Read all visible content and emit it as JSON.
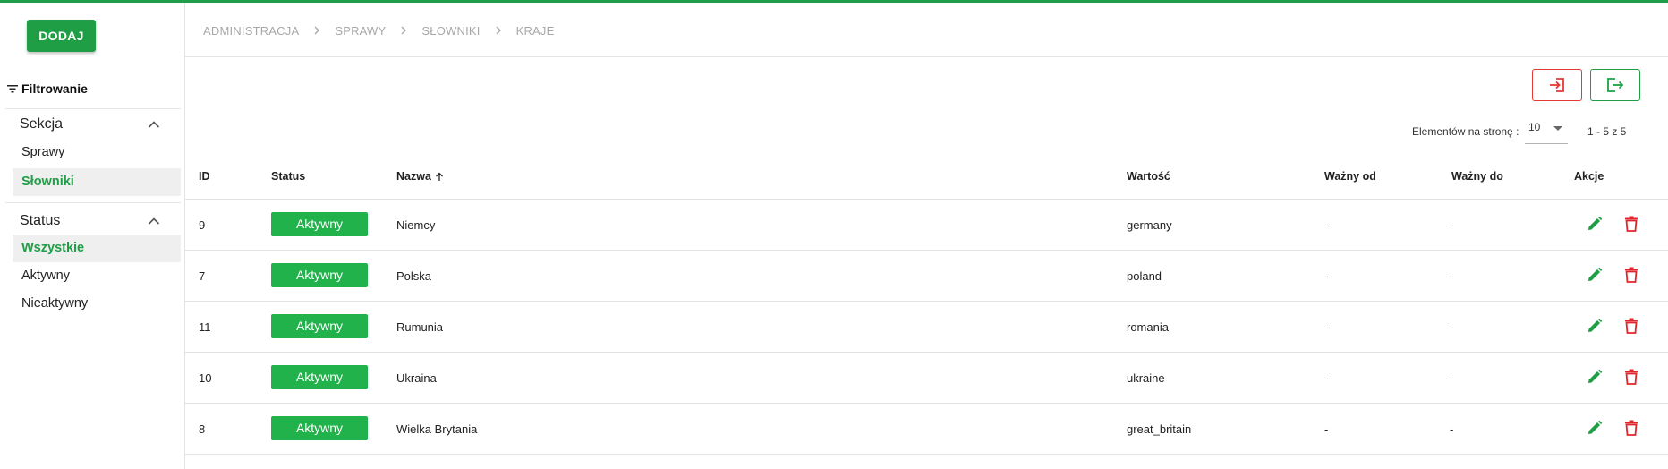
{
  "sidebar": {
    "add_label": "DODAJ",
    "filter_label": "Filtrowanie",
    "sections": [
      {
        "title": "Sekcja",
        "items": [
          {
            "label": "Sprawy",
            "active": false
          },
          {
            "label": "Słowniki",
            "active": true
          }
        ]
      },
      {
        "title": "Status",
        "items": [
          {
            "label": "Wszystkie",
            "active": true
          },
          {
            "label": "Aktywny",
            "active": false
          },
          {
            "label": "Nieaktywny",
            "active": false
          }
        ]
      }
    ]
  },
  "breadcrumb": [
    "ADMINISTRACJA",
    "SPRAWY",
    "SŁOWNIKI",
    "KRAJE"
  ],
  "pagination": {
    "per_page_label": "Elementów na stronę :",
    "per_page_value": "10",
    "range": "1 - 5 z 5"
  },
  "table": {
    "headers": {
      "id": "ID",
      "status": "Status",
      "name": "Nazwa",
      "value": "Wartość",
      "valid_from": "Ważny od",
      "valid_to": "Ważny do",
      "actions": "Akcje"
    },
    "rows": [
      {
        "id": "9",
        "status": "Aktywny",
        "name": "Niemcy",
        "value": "germany",
        "valid_from": "-",
        "valid_to": "-"
      },
      {
        "id": "7",
        "status": "Aktywny",
        "name": "Polska",
        "value": "poland",
        "valid_from": "-",
        "valid_to": "-"
      },
      {
        "id": "11",
        "status": "Aktywny",
        "name": "Rumunia",
        "value": "romania",
        "valid_from": "-",
        "valid_to": "-"
      },
      {
        "id": "10",
        "status": "Aktywny",
        "name": "Ukraina",
        "value": "ukraine",
        "valid_from": "-",
        "valid_to": "-"
      },
      {
        "id": "8",
        "status": "Aktywny",
        "name": "Wielka Brytania",
        "value": "great_britain",
        "valid_from": "-",
        "valid_to": "-"
      }
    ]
  },
  "icons": {
    "filter": "filter-icon",
    "chevron": "chevron-up-icon",
    "import": "import-icon",
    "export": "export-icon",
    "sort": "sort-arrow-up-icon",
    "edit": "pencil-icon",
    "delete": "trash-icon"
  },
  "colors": {
    "primary": "#1f9e46",
    "badge": "#22b24c",
    "danger": "#e53935",
    "active_bg": "#efefef"
  }
}
